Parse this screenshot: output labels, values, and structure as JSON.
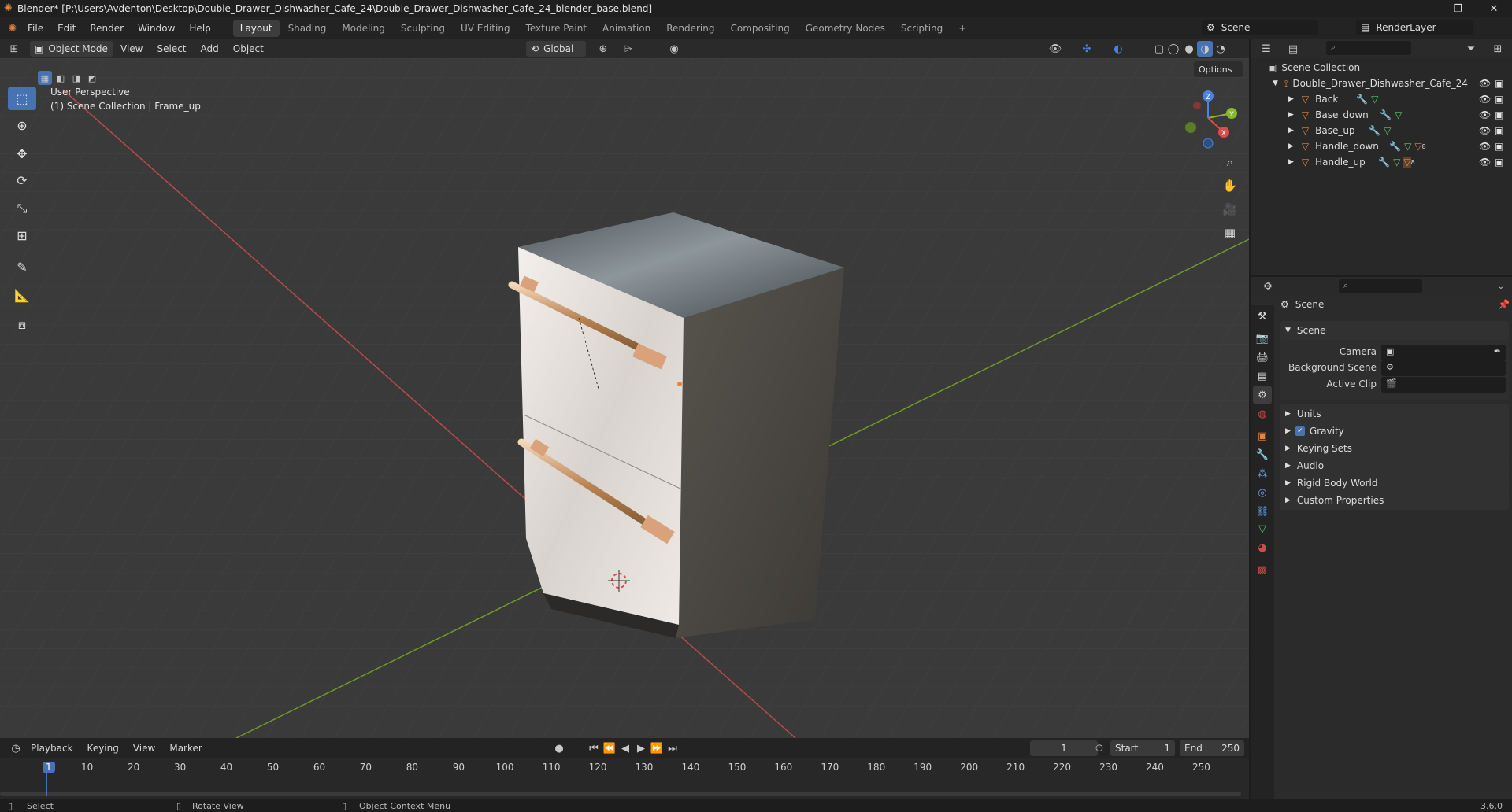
{
  "window": {
    "title": "Blender* [P:\\Users\\Avdenton\\Desktop\\Double_Drawer_Dishwasher_Cafe_24\\Double_Drawer_Dishwasher_Cafe_24_blender_base.blend]",
    "minimize": "–",
    "maximize": "❐",
    "close": "✕"
  },
  "menu": [
    "File",
    "Edit",
    "Render",
    "Window",
    "Help"
  ],
  "workspaces": [
    "Layout",
    "Shading",
    "Modeling",
    "Sculpting",
    "UV Editing",
    "Texture Paint",
    "Animation",
    "Rendering",
    "Compositing",
    "Geometry Nodes",
    "Scripting"
  ],
  "active_workspace": "Layout",
  "add_workspace": "+",
  "scene_selector": {
    "label": "Scene"
  },
  "render_layer_selector": {
    "label": "RenderLayer"
  },
  "viewport_header": {
    "mode": "Object Mode",
    "menus": [
      "View",
      "Select",
      "Add",
      "Object"
    ],
    "orientation": "Global",
    "options": "Options"
  },
  "viewport": {
    "perspective": "User Perspective",
    "collection_info": "(1) Scene Collection | Frame_up",
    "gizmo": {
      "x": "X",
      "y": "Y",
      "z": "Z"
    }
  },
  "outliner": {
    "root": "Scene Collection",
    "collection": "Double_Drawer_Dishwasher_Cafe_24",
    "objects": [
      "Back",
      "Base_down",
      "Base_up",
      "Handle_down",
      "Handle_up"
    ],
    "badge_count": "8"
  },
  "properties": {
    "context_title": "Scene",
    "section": "Scene",
    "fields": [
      {
        "label": "Camera",
        "value": ""
      },
      {
        "label": "Background Scene",
        "value": ""
      },
      {
        "label": "Active Clip",
        "value": ""
      }
    ],
    "panels": [
      "Units",
      "Gravity",
      "Keying Sets",
      "Audio",
      "Rigid Body World",
      "Custom Properties"
    ],
    "gravity_checked": true
  },
  "timeline": {
    "menus": [
      "Playback",
      "Keying",
      "View",
      "Marker"
    ],
    "current_frame": "1",
    "start_label": "Start",
    "start": "1",
    "end_label": "End",
    "end": "250",
    "ruler": [
      "1",
      "10",
      "20",
      "30",
      "40",
      "50",
      "60",
      "70",
      "80",
      "90",
      "100",
      "110",
      "120",
      "130",
      "140",
      "150",
      "160",
      "170",
      "180",
      "190",
      "200",
      "210",
      "220",
      "230",
      "240",
      "250"
    ]
  },
  "statusbar": {
    "select": "Select",
    "rotate": "Rotate View",
    "context": "Object Context Menu",
    "version": "3.6.0"
  },
  "colors": {
    "accent": "#4772b3",
    "x_axis": "#e04a4a",
    "y_axis": "#8ab72c",
    "z_axis": "#4a84e0",
    "object_orange": "#e8843a"
  }
}
